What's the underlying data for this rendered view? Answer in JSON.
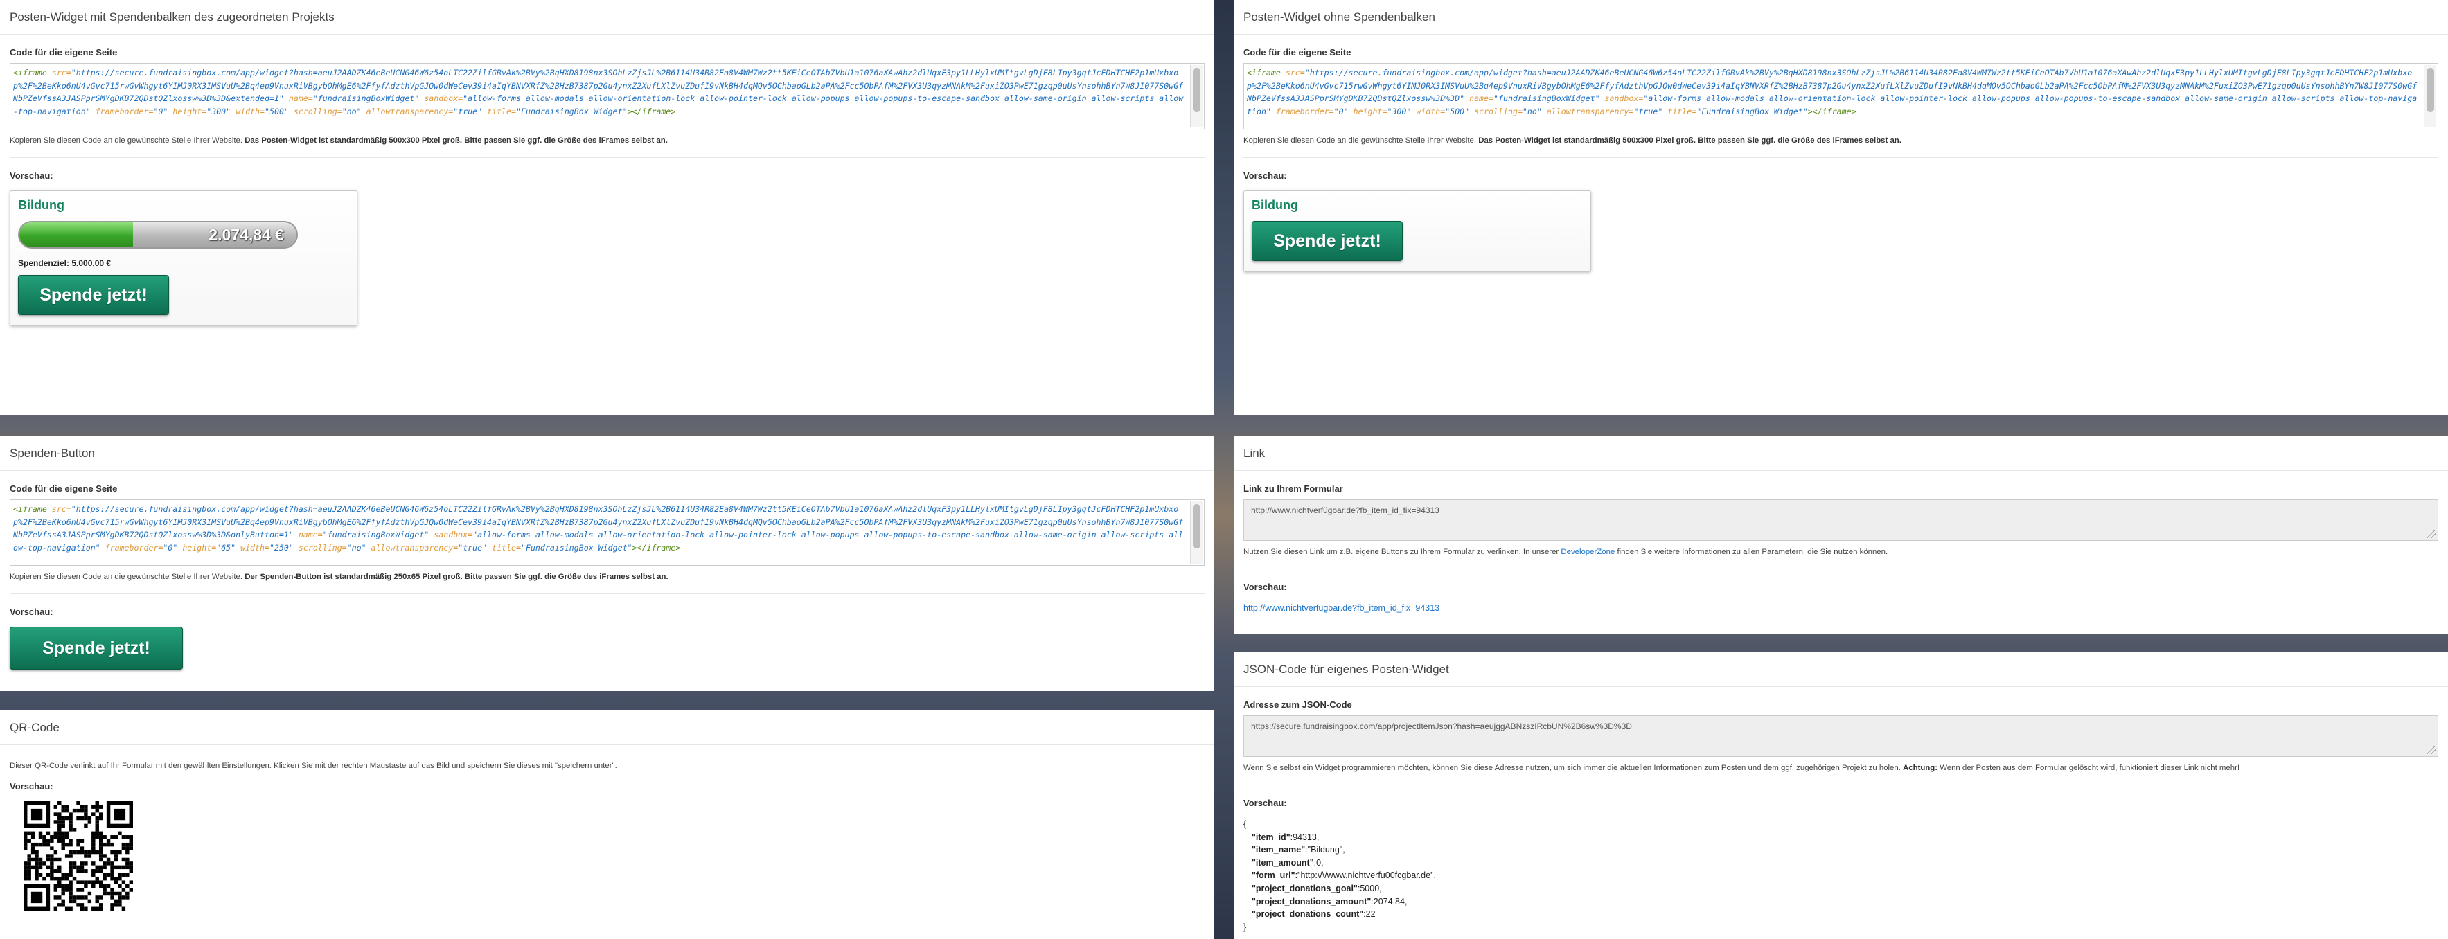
{
  "embed_code_label": "Code für die eigene Seite",
  "preview_label": "Vorschau:",
  "widget_bar": {
    "title": "Posten-Widget mit Spendenbalken des zugeordneten Projekts",
    "code": {
      "tag_open": "<iframe",
      "src_attr": "src=",
      "src_value": "\"https://secure.fundraisingbox.com/app/widget?hash=aeuJ2AADZK46eBeUCNG46W6z54oLTC22ZilfGRvAk%2BVy%2BqHXD8198nx3SOhLzZjsJL%2B6114U34R82Ea8V4WM7Wz2tt5KEiCeOTAb7VbU1a1076aXAwAhz2dlUqxF3py1LLHylxUMItgvLgDjF8LIpy3gqtJcFDHTCHF2p1mUxbxop%2F%2BeKko6nU4vGvc715rwGvWhgyt6YIMJ0RX3IMSVuU%2Bq4ep9VnuxRiVBgybOhMgE6%2FfyfAdzthVpGJQw0dWeCev39i4aIqYBNVXRfZ%2BHzB7387p2Gu4ynxZ2XufLXlZvuZDufI9vNkBH4dqMQv5OChbaoGLb2aPA%2Fcc5ObPAfM%2FVX3U3qyzMNAkM%2FuxiZO3PwE71gzqp0uUsYnsohhBYn7W8JI077S0wGfNbPZeVfssA3JASPprSMYgDKB72QDstQZlxossw%3D%3D&extended=1\"",
      "rest": [
        {
          "a": " name=",
          "v": "\"fundraisingBoxWidget\""
        },
        {
          "a": " sandbox=",
          "v": "\"allow-forms allow-modals allow-orientation-lock allow-pointer-lock allow-popups allow-popups-to-escape-sandbox allow-same-origin allow-scripts allow-top-navigation\""
        },
        {
          "a": " frameborder=",
          "v": "\"0\""
        },
        {
          "a": " height=",
          "v": "\"300\""
        },
        {
          "a": " width=",
          "v": "\"500\""
        },
        {
          "a": " scrolling=",
          "v": "\"no\""
        },
        {
          "a": " allowtransparency=",
          "v": "\"true\""
        },
        {
          "a": " title=",
          "v": "\"FundraisingBox Widget\""
        }
      ],
      "tag_close": "></iframe>"
    },
    "hint_plain": "Kopieren Sie diesen Code an die gewünschte Stelle Ihrer Website. ",
    "hint_bold": "Das Posten-Widget ist standardmäßig 500x300 Pixel groß. Bitte passen Sie ggf. die Größe des iFrames selbst an.",
    "widget_title": "Bildung",
    "amount": "2.074,84 €",
    "progress_fraction": 0.41,
    "goal_text": "Spendenziel: 5.000,00 €",
    "button": "Spende jetzt!"
  },
  "widget_nobar": {
    "title": "Posten-Widget ohne Spendenbalken",
    "code": {
      "tag_open": "<iframe",
      "src_attr": "src=",
      "src_value": "\"https://secure.fundraisingbox.com/app/widget?hash=aeuJ2AADZK46eBeUCNG46W6z54oLTC22ZilfGRvAk%2BVy%2BqHXD8198nx3SOhLzZjsJL%2B6114U34R82Ea8V4WM7Wz2tt5KEiCeOTAb7VbU1a1076aXAwAhz2dlUqxF3py1LLHylxUMItgvLgDjF8LIpy3gqtJcFDHTCHF2p1mUxbxop%2F%2BeKko6nU4vGvc715rwGvWhgyt6YIMJ0RX3IMSVuU%2Bq4ep9VnuxRiVBgybOhMgE6%2FfyfAdzthVpGJQw0dWeCev39i4aIqYBNVXRfZ%2BHzB7387p2Gu4ynxZ2XufLXlZvuZDufI9vNkBH4dqMQv5OChbaoGLb2aPA%2Fcc5ObPAfM%2FVX3U3qyzMNAkM%2FuxiZO3PwE71gzqp0uUsYnsohhBYn7W8JI077S0wGfNbPZeVfssA3JASPprSMYgDKB72QDstQZlxossw%3D%3D\"",
      "rest": [
        {
          "a": " name=",
          "v": "\"fundraisingBoxWidget\""
        },
        {
          "a": " sandbox=",
          "v": "\"allow-forms allow-modals allow-orientation-lock allow-pointer-lock allow-popups allow-popups-to-escape-sandbox allow-same-origin allow-scripts allow-top-navigation\""
        },
        {
          "a": " frameborder=",
          "v": "\"0\""
        },
        {
          "a": " height=",
          "v": "\"300\""
        },
        {
          "a": " width=",
          "v": "\"500\""
        },
        {
          "a": " scrolling=",
          "v": "\"no\""
        },
        {
          "a": " allowtransparency=",
          "v": "\"true\""
        },
        {
          "a": " title=",
          "v": "\"FundraisingBox Widget\""
        }
      ],
      "tag_close": "></iframe>"
    },
    "hint_plain": "Kopieren Sie diesen Code an die gewünschte Stelle Ihrer Website. ",
    "hint_bold": "Das Posten-Widget ist standardmäßig 500x300 Pixel groß. Bitte passen Sie ggf. die Größe des iFrames selbst an.",
    "widget_title": "Bildung",
    "button": "Spende jetzt!"
  },
  "donate_button": {
    "title": "Spenden-Button",
    "code": {
      "tag_open": "<iframe",
      "src_attr": "src=",
      "src_value": "\"https://secure.fundraisingbox.com/app/widget?hash=aeuJ2AADZK46eBeUCNG46W6z54oLTC22ZilfGRvAk%2BVy%2BqHXD8198nx3SOhLzZjsJL%2B6114U34R82Ea8V4WM7Wz2tt5KEiCeOTAb7VbU1a1076aXAwAhz2dlUqxF3py1LLHylxUMItgvLgDjF8LIpy3gqtJcFDHTCHF2p1mUxbxop%2F%2BeKko6nU4vGvc715rwGvWhgyt6YIMJ0RX3IMSVuU%2Bq4ep9VnuxRiVBgybOhMgE6%2FfyfAdzthVpGJQw0dWeCev39i4aIqYBNVXRfZ%2BHzB7387p2Gu4ynxZ2XufLXlZvuZDufI9vNkBH4dqMQv5OChbaoGLb2aPA%2Fcc5ObPAfM%2FVX3U3qyzMNAkM%2FuxiZO3PwE71gzqp0uUsYnsohhBYn7W8JI077S0wGfNbPZeVfssA3JASPprSMYgDKB72QDstQZlxossw%3D%3D&onlyButton=1\"",
      "rest": [
        {
          "a": " name=",
          "v": "\"fundraisingBoxWidget\""
        },
        {
          "a": " sandbox=",
          "v": "\"allow-forms allow-modals allow-orientation-lock allow-pointer-lock allow-popups allow-popups-to-escape-sandbox allow-same-origin allow-scripts allow-top-navigation\""
        },
        {
          "a": " frameborder=",
          "v": "\"0\""
        },
        {
          "a": " height=",
          "v": "\"65\""
        },
        {
          "a": " width=",
          "v": "\"250\""
        },
        {
          "a": " scrolling=",
          "v": "\"no\""
        },
        {
          "a": " allowtransparency=",
          "v": "\"true\""
        },
        {
          "a": " title=",
          "v": "\"FundraisingBox Widget\""
        }
      ],
      "tag_close": "></iframe>"
    },
    "hint_plain": "Kopieren Sie diesen Code an die gewünschte Stelle Ihrer Website. ",
    "hint_bold": "Der Spenden-Button ist standardmäßig 250x65 Pixel groß. Bitte passen Sie ggf. die Größe des iFrames selbst an.",
    "button": "Spende jetzt!"
  },
  "qr": {
    "title": "QR-Code",
    "hint": "Dieser QR-Code verlinkt auf Ihr Formular mit den gewählten Einstellungen. Klicken Sie mit der rechten Maustaste auf das Bild und speichern Sie dieses mit \"speichern unter\"."
  },
  "link": {
    "title": "Link",
    "field_label": "Link zu Ihrem Formular",
    "url": "http://www.nichtverfügbar.de?fb_item_id_fix=94313",
    "hint_before": "Nutzen Sie diesen Link um z.B. eigene Buttons zu Ihrem Formular zu verlinken. In unserer ",
    "hint_link": "DeveloperZone",
    "hint_after": " finden Sie weitere Informationen zu allen Parametern, die Sie nutzen können.",
    "preview_link": "http://www.nichtverfügbar.de?fb_item_id_fix=94313"
  },
  "json_widget": {
    "title": "JSON-Code für eigenes Posten-Widget",
    "field_label": "Adresse zum JSON-Code",
    "url": "https://secure.fundraisingbox.com/app/projectItemJson?hash=aeujggABNzszIRcbUN%2B6sw%3D%3D",
    "hint_plain": "Wenn Sie selbst ein Widget programmieren möchten, können Sie diese Adresse nutzen, um sich immer die aktuellen Informationen zum Posten und dem ggf. zugehörigen Projekt zu holen. ",
    "hint_bold": "Achtung:",
    "hint_after": " Wenn der Posten aus dem Formular gelöscht wird, funktioniert dieser Link nicht mehr!",
    "open_brace": "{",
    "close_brace": "}",
    "rows": [
      {
        "k": "\"item_id\"",
        "v": ":94313,"
      },
      {
        "k": "\"item_name\"",
        "v": ":\"Bildung\","
      },
      {
        "k": "\"item_amount\"",
        "v": ":0,"
      },
      {
        "k": "\"form_url\"",
        "v": ":\"http:\\/\\/www.nichtverfu00fcgbar.de\","
      },
      {
        "k": "\"project_donations_goal\"",
        "v": ":5000,"
      },
      {
        "k": "\"project_donations_amount\"",
        "v": ":2074.84,"
      },
      {
        "k": "\"project_donations_count\"",
        "v": ":22"
      }
    ]
  },
  "colors": {
    "brand_green": "#12855e",
    "link_blue": "#1a73c8"
  }
}
